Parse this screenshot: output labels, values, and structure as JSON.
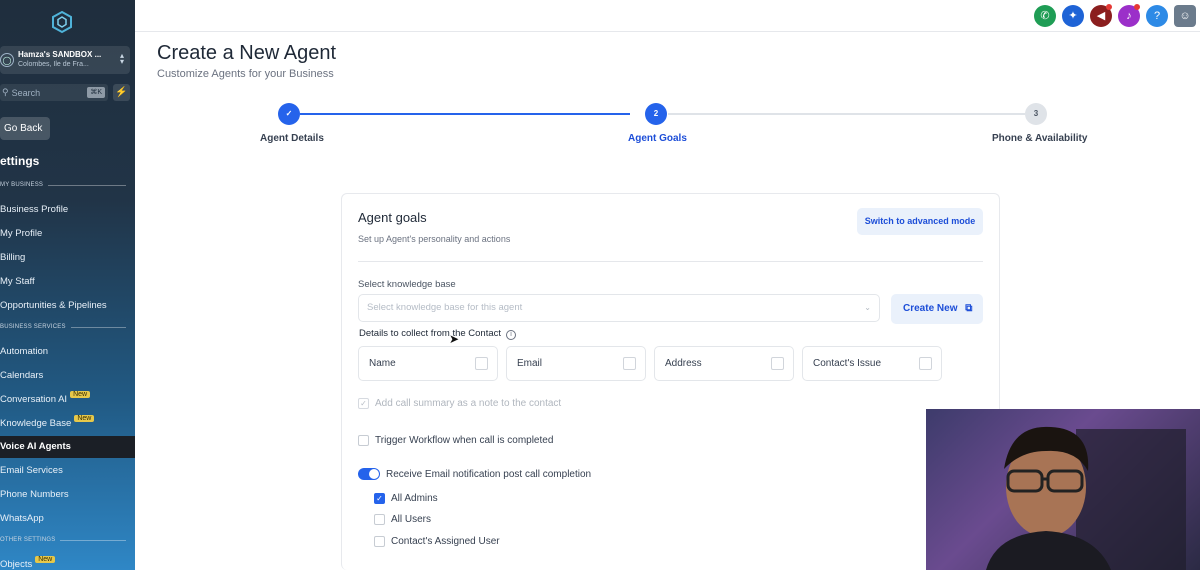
{
  "sidebar": {
    "account": {
      "name": "Hamza's SANDBOX ...",
      "location": "Colombes, Ile de Fra..."
    },
    "search": {
      "placeholder": "Search",
      "shortcut": "⌘K"
    },
    "go_back": "Go Back",
    "settings_title": "ettings",
    "sections": {
      "my_business": "MY BUSINESS",
      "business_services": "BUSINESS SERVICES",
      "other_settings": "OTHER SETTINGS"
    },
    "my_business_items": [
      "Business Profile",
      "My Profile",
      "Billing",
      "My Staff",
      "Opportunities & Pipelines"
    ],
    "business_services_items": [
      "Automation",
      "Calendars",
      "Conversation AI",
      "Knowledge Base",
      "Voice AI Agents",
      "Email Services",
      "Phone Numbers",
      "WhatsApp"
    ],
    "other_items": [
      "Objects"
    ],
    "new_badge": "New",
    "active_item": "Voice AI Agents"
  },
  "topbar": {
    "icons": [
      {
        "name": "phone-icon",
        "color": "#1f9d55"
      },
      {
        "name": "magic-icon",
        "color": "#1e63d6"
      },
      {
        "name": "megaphone-icon",
        "color": "#8b1e1e"
      },
      {
        "name": "bell-icon",
        "color": "#9b2fc9"
      },
      {
        "name": "help-icon",
        "color": "#2d8ae6"
      },
      {
        "name": "avatar-icon",
        "color": "#6b7b8c"
      }
    ],
    "help_glyph": "?"
  },
  "page": {
    "title": "Create a New Agent",
    "subtitle": "Customize Agents for your Business"
  },
  "stepper": {
    "steps": [
      {
        "number": "✓",
        "label": "Agent Details",
        "state": "done"
      },
      {
        "number": "2",
        "label": "Agent Goals",
        "state": "active"
      },
      {
        "number": "3",
        "label": "Phone & Availability",
        "state": "pending"
      }
    ],
    "accent": "#2563eb"
  },
  "card": {
    "title": "Agent goals",
    "subtitle": "Set up Agent's personality and actions",
    "advanced_button": "Switch to advanced mode",
    "kb_label": "Select knowledge base",
    "kb_placeholder": "Select knowledge base for this agent",
    "create_new": "Create New",
    "details_label": "Details to collect from the Contact",
    "fields": [
      "Name",
      "Email",
      "Address",
      "Contact's Issue"
    ],
    "call_summary": "Add call summary as a note to the contact",
    "trigger_workflow": "Trigger Workflow when call is completed",
    "email_notification": "Receive Email notification post call completion",
    "recipients": [
      {
        "label": "All Admins",
        "checked": true
      },
      {
        "label": "All Users",
        "checked": false
      },
      {
        "label": "Contact's Assigned User",
        "checked": false
      }
    ]
  }
}
